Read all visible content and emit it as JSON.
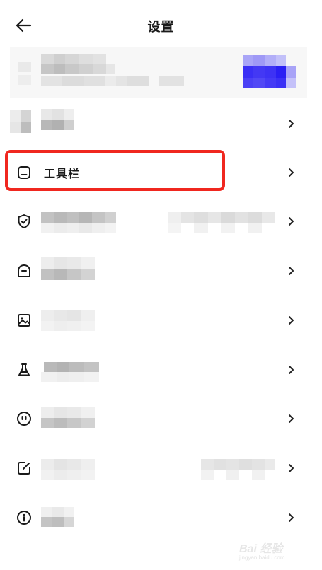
{
  "header": {
    "title": "设置",
    "back_icon": "arrow-left-icon"
  },
  "settings_rows": [
    {
      "id": "row-1",
      "icon": "blurred",
      "label": ""
    },
    {
      "id": "toolbar",
      "icon": "toolbar-icon",
      "label": "工具栏"
    },
    {
      "id": "row-3",
      "icon": "shield-check-icon",
      "label": ""
    },
    {
      "id": "row-4",
      "icon": "face-minus-icon",
      "label": ""
    },
    {
      "id": "row-5",
      "icon": "image-icon",
      "label": ""
    },
    {
      "id": "row-6",
      "icon": "flask-icon",
      "label": ""
    },
    {
      "id": "row-7",
      "icon": "smiley-face-icon",
      "label": ""
    },
    {
      "id": "row-8",
      "icon": "edit-square-icon",
      "label": ""
    },
    {
      "id": "row-9",
      "icon": "info-circle-icon",
      "label": ""
    }
  ],
  "colors": {
    "highlight": "#f0271f",
    "avatar_blue": "#3a2ff5",
    "text": "#1a1a1a"
  },
  "watermark": {
    "text": "Bai 经验",
    "sub": "jingyan.baidu.com"
  }
}
